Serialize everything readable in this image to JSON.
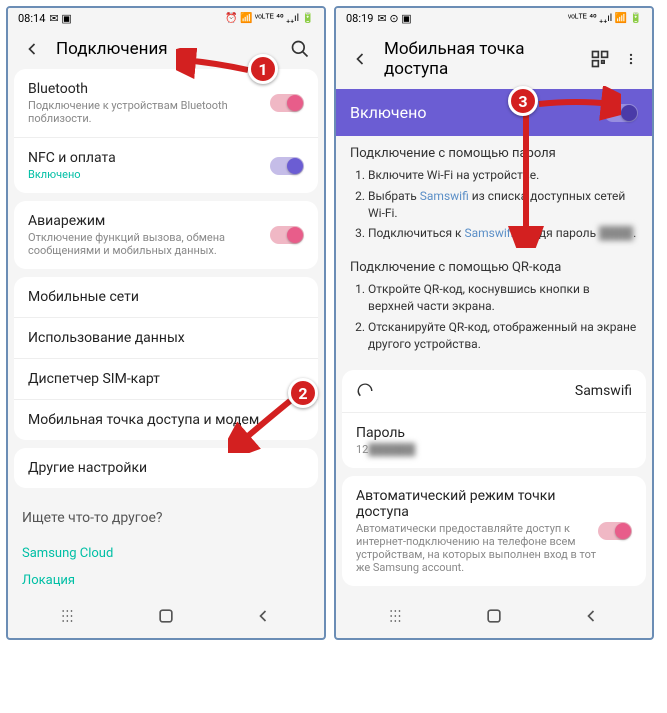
{
  "phone1": {
    "time": "08:14",
    "status_icons": "⏰ 📶 ᵛᵒᴸᵀᴱ ⁴⁰ ₊₊ıl 🔋",
    "header": {
      "title": "Подключения"
    },
    "bluetooth": {
      "title": "Bluetooth",
      "sub": "Подключение к устройствам Bluetooth поблизости."
    },
    "nfc": {
      "title": "NFC и оплата",
      "sub": "Включено"
    },
    "airplane": {
      "title": "Авиарежим",
      "sub": "Отключение функций вызова, обмена сообщениями и мобильных данных."
    },
    "mobile_networks": "Мобильные сети",
    "data_usage": "Использование данных",
    "sim_manager": "Диспетчер SIM-карт",
    "hotspot": "Мобильная точка доступа и модем",
    "other": "Другие настройки",
    "prompt": "Ищете что-то другое?",
    "link1": "Samsung Cloud",
    "link2": "Локация"
  },
  "phone2": {
    "time": "08:19",
    "status_icons": "ᵛᵒᴸᵀᴱ ⁴⁰ ₊₊ıl 📶 🔋",
    "header": {
      "title": "Мобильная точка доступа"
    },
    "enabled": "Включено",
    "pwd_title": "Подключение с помощью пароля",
    "step1": "Включите Wi-Fi на устройстве.",
    "step2a": "Выбрать ",
    "step2_link": "Samswifi",
    "step2b": " из списка доступных сетей Wi-Fi.",
    "step3a": "Подключиться к ",
    "step3_link": "Samswifi",
    "step3b": ", введя пароль ",
    "qr_title": "Подключение с помощью QR-кода",
    "qr_step1": "Откройте QR-код, коснувшись кнопки в верхней части экрана.",
    "qr_step2": "Отсканируйте QR-код, отображенный на экране другого устройства.",
    "network_name": "Samswifi",
    "password_label": "Пароль",
    "password_value": "12",
    "auto_title": "Автоматический режим точки доступа",
    "auto_sub": "Автоматически предоставляйте доступ к интернет-подключению на телефоне всем устройствам, на которых выполнен вход в тот же Samsung account."
  },
  "badges": {
    "b1": "1",
    "b2": "2",
    "b3": "3"
  }
}
